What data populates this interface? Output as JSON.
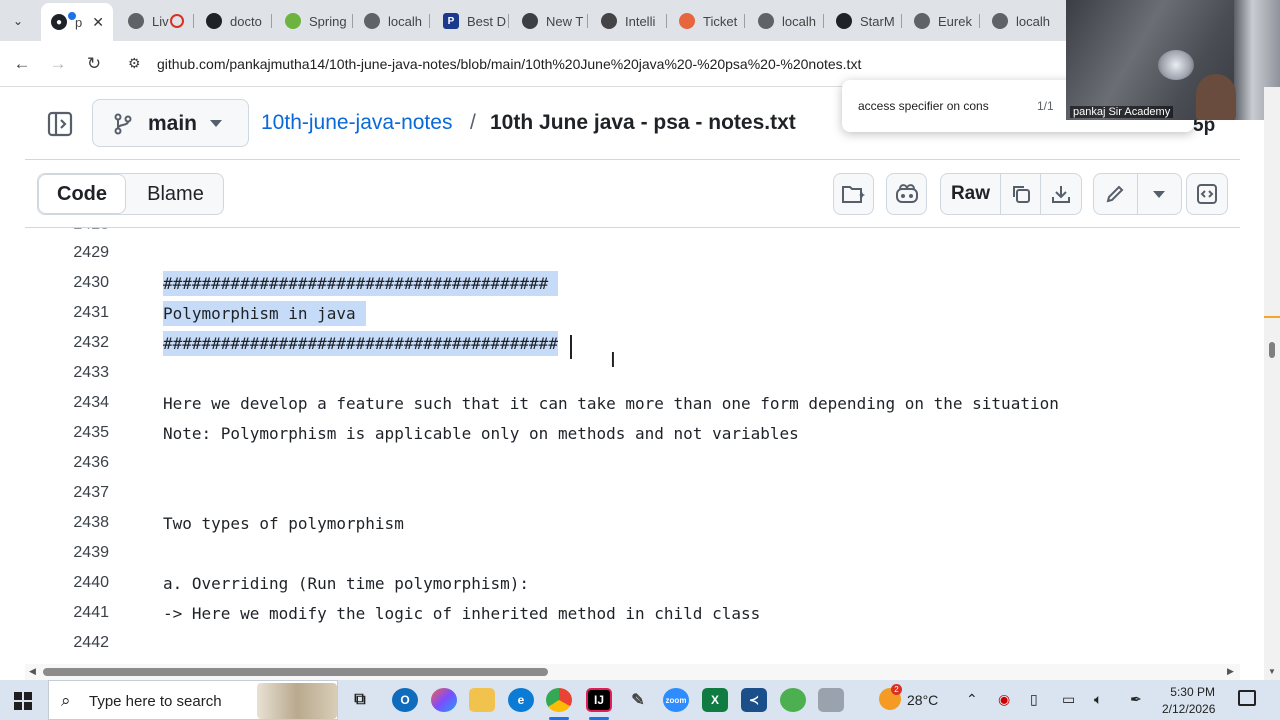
{
  "browser": {
    "tabs": [
      {
        "label": "p",
        "icon": "github-icon",
        "active": true
      },
      {
        "label": "Liv",
        "icon": "globe-icon"
      },
      {
        "label": "docto",
        "icon": "github-icon"
      },
      {
        "label": "Spring",
        "icon": "spring-icon"
      },
      {
        "label": "localh",
        "icon": "globe-icon"
      },
      {
        "label": "Best D",
        "icon": "p-icon"
      },
      {
        "label": "New T",
        "icon": "chrome-icon"
      },
      {
        "label": "Intelli",
        "icon": "openai-icon"
      },
      {
        "label": "Ticket",
        "icon": "ticket-icon"
      },
      {
        "label": "localh",
        "icon": "globe-icon"
      },
      {
        "label": "StarM",
        "icon": "github-icon"
      },
      {
        "label": "Eurek",
        "icon": "globe-icon"
      },
      {
        "label": "localh",
        "icon": "globe-icon"
      }
    ],
    "url": "github.com/pankajmutha14/10th-june-java-notes/blob/main/10th%20June%20java%20-%20psa%20-%20notes.txt"
  },
  "find_popup": {
    "query": "access specifier on cons",
    "count": "1/1"
  },
  "webcam": {
    "name": "pankaj Sir Academy"
  },
  "repo": {
    "branch": "main",
    "repo_name": "10th-june-java-notes",
    "separator": "/",
    "file_name": "10th June java - psa - notes.txt",
    "overflow_text": "5p"
  },
  "file_toolbar": {
    "code_label": "Code",
    "blame_label": "Blame",
    "raw_label": "Raw"
  },
  "code_lines": [
    {
      "num": "2429",
      "text": ""
    },
    {
      "num": "2430",
      "text": "########################################",
      "selected": true
    },
    {
      "num": "2431",
      "text": "Polymorphism in java",
      "selected": true
    },
    {
      "num": "2432",
      "text": "#########################################",
      "selected": true
    },
    {
      "num": "2433",
      "text": ""
    },
    {
      "num": "2434",
      "text": "Here we develop a feature such that it can take more than one form depending on the situation"
    },
    {
      "num": "2435",
      "text": "Note: Polymorphism is applicable only on methods and not variables"
    },
    {
      "num": "2436",
      "text": ""
    },
    {
      "num": "2437",
      "text": ""
    },
    {
      "num": "2438",
      "text": "Two types of polymorphism"
    },
    {
      "num": "2439",
      "text": ""
    },
    {
      "num": "2440",
      "text": "a. Overriding (Run time polymorphism):"
    },
    {
      "num": "2441",
      "text": "-> Here we modify the logic of inherited method in child class"
    },
    {
      "num": "2442",
      "text": ""
    }
  ],
  "taskbar": {
    "search_placeholder": "Type here to search",
    "weather_badge": "2",
    "temperature": "28°C",
    "time": "5:30 PM",
    "date": "2/12/2026"
  },
  "colors": {
    "selection": "#c6dbf7",
    "link": "#0969da",
    "tabstrip": "#dfe3e8",
    "taskbar": "#d9e4f0"
  }
}
